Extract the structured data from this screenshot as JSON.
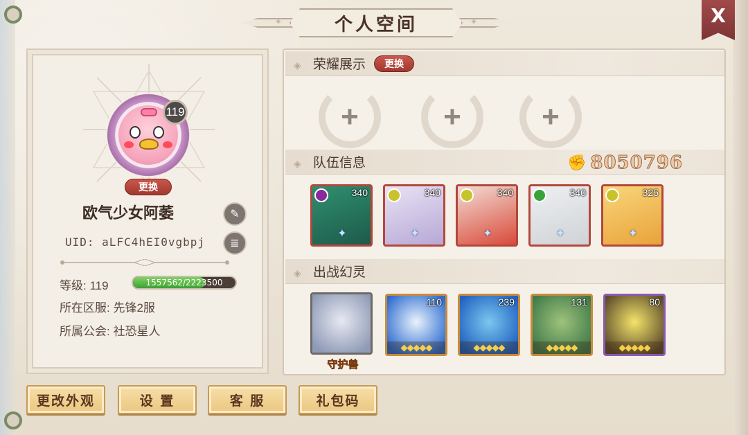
{
  "window": {
    "title": "个人空间",
    "close_label": "X"
  },
  "profile": {
    "level_badge": "119",
    "change_avatar_label": "更换",
    "name": "欧气少女阿萎",
    "uid": "UID: aLFC4hEI0vgbpj",
    "level_label": "等级: 119",
    "exp_text": "1557562/2223500",
    "exp_fraction": 0.7,
    "server_label": "所在区服: 先锋2服",
    "guild_label": "所属公会: 社恐星人"
  },
  "honor": {
    "title": "荣耀展示",
    "change_label": "更换",
    "slots": [
      "empty-slot",
      "empty-slot",
      "empty-slot"
    ]
  },
  "team": {
    "title": "队伍信息",
    "power": "8050796",
    "members": [
      {
        "level": "340",
        "element_color": "#8a2a9a",
        "art": [
          "#1d5a4a",
          "#2f8f6f"
        ]
      },
      {
        "level": "340",
        "element_color": "#c8c32a",
        "art": [
          "#b7a8d6",
          "#e8e2f4"
        ]
      },
      {
        "level": "340",
        "element_color": "#c8c32a",
        "art": [
          "#d94a3a",
          "#f2dcd4"
        ]
      },
      {
        "level": "340",
        "element_color": "#3aa23a",
        "art": [
          "#cfd2d6",
          "#eef0f2"
        ]
      },
      {
        "level": "325",
        "element_color": "#c8c32a",
        "art": [
          "#e9a23a",
          "#f8d67a"
        ]
      }
    ]
  },
  "spirits": {
    "title": "出战幻灵",
    "guardian_label": "守护兽",
    "items": [
      {
        "level": "",
        "art": [
          "#8f9ab5",
          "#e6e9f2"
        ],
        "stars": ""
      },
      {
        "level": "110",
        "art": [
          "#2a6ad0",
          "#e9f2fb"
        ],
        "stars": "◆◆◆◆◆"
      },
      {
        "level": "239",
        "art": [
          "#1f5fc0",
          "#7ac7ef"
        ],
        "stars": "◆◆◆◆◆"
      },
      {
        "level": "131",
        "art": [
          "#3f7a4a",
          "#9fc27a"
        ],
        "stars": "◆◆◆◆◆"
      },
      {
        "level": "80",
        "art": [
          "#5b4a2a",
          "#f4e46a"
        ],
        "stars": "◆◆◆◆◆"
      }
    ]
  },
  "buttons": {
    "appearance": "更改外观",
    "settings": "设 置",
    "support": "客 服",
    "gift_code": "礼包码"
  },
  "colors": {
    "accent_red": "#a2382f",
    "gold": "#ecc680",
    "panel": "#f5f0e8"
  }
}
